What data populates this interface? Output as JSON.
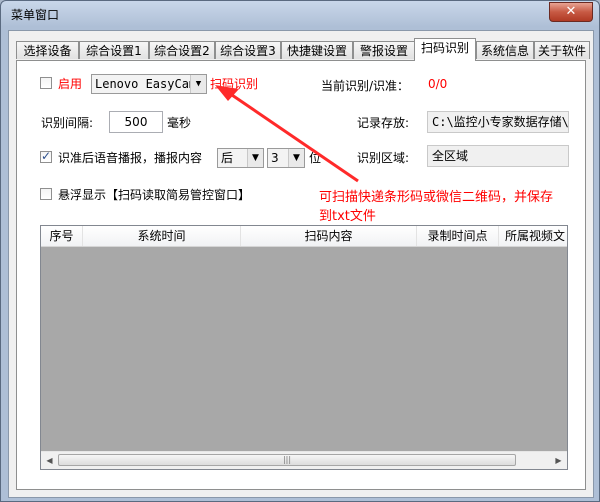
{
  "window": {
    "title": "菜单窗口",
    "close_label": "✕"
  },
  "tabs": [
    {
      "label": "选择设备",
      "active": false
    },
    {
      "label": "综合设置1",
      "active": false
    },
    {
      "label": "综合设置2",
      "active": false
    },
    {
      "label": "综合设置3",
      "active": false
    },
    {
      "label": "快捷键设置",
      "active": false
    },
    {
      "label": "警报设置",
      "active": false
    },
    {
      "label": "扫码识别",
      "active": true
    },
    {
      "label": "系统信息",
      "active": false
    },
    {
      "label": "关于软件",
      "active": false
    }
  ],
  "scan": {
    "enable_label": "启用",
    "enable_checked": false,
    "device_value": "Lenovo EasyCame",
    "scan_label": "扫码识别",
    "rate_label": "当前识别/识准：",
    "rate_value": "0/0",
    "interval_label": "识别间隔:",
    "interval_value": "500",
    "interval_unit": "毫秒",
    "record_label": "记录存放:",
    "record_path": "C:\\监控小专家数据存储\\",
    "voice_label": "识准后语音播报，播报内容",
    "voice_checked": true,
    "voice_pos_value": "后",
    "voice_digits_value": "3",
    "voice_unit": "位",
    "region_label": "识别区域:",
    "region_value": "全区域",
    "float_label": "悬浮显示【扫码读取简易管控窗口】",
    "float_checked": false
  },
  "annotation": {
    "line1": "可扫描快递条形码或微信二维码，并保存",
    "line2": "到txt文件",
    "color": "#ff0000"
  },
  "table": {
    "columns": [
      "序号",
      "系统时间",
      "扫码内容",
      "录制时间点",
      "所属视频文"
    ],
    "rows": []
  }
}
